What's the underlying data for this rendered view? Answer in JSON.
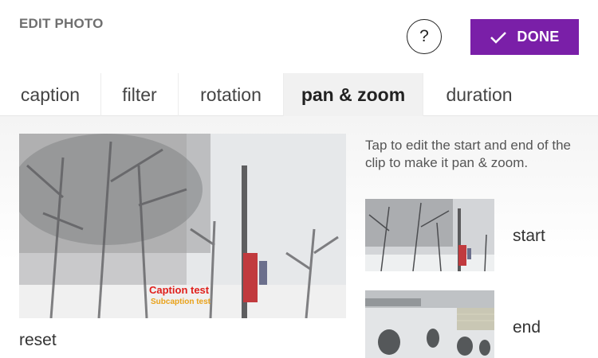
{
  "header": {
    "title": "EDIT PHOTO",
    "help_label": "?",
    "done_label": "DONE",
    "accent_color": "#7a1fa8"
  },
  "tabs": [
    {
      "label": "caption",
      "active": false
    },
    {
      "label": "filter",
      "active": false
    },
    {
      "label": "rotation",
      "active": false
    },
    {
      "label": "pan & zoom",
      "active": true
    },
    {
      "label": "duration",
      "active": false
    }
  ],
  "preview": {
    "caption": "Caption test",
    "subcaption": "Subcaption test"
  },
  "reset_label": "reset",
  "instructions": "Tap to edit the start and end of the clip to make it pan & zoom.",
  "thumbnails": {
    "start_label": "start",
    "end_label": "end"
  },
  "icons": {
    "done": "checkmark-icon"
  }
}
